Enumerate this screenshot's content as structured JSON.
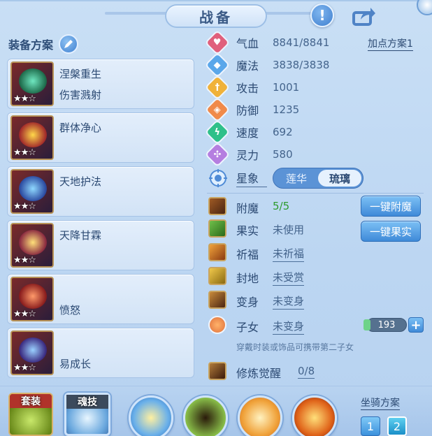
{
  "window": {
    "title": "战备"
  },
  "left": {
    "plan_title": "装备方案",
    "plans": [
      {
        "name_line1": "涅槃重生",
        "name_line2": "伤害溅射",
        "stars": "★★☆"
      },
      {
        "name_line1": "群体净心",
        "name_line2": "",
        "stars": "★★☆"
      },
      {
        "name_line1": "天地护法",
        "name_line2": "",
        "stars": "★★☆"
      },
      {
        "name_line1": "天降甘霖",
        "name_line2": "",
        "stars": "★★☆"
      },
      {
        "name_line1": "",
        "name_line2": "愤怒",
        "stars": "★★☆"
      },
      {
        "name_line1": "",
        "name_line2": "易成长",
        "stars": "★★☆"
      }
    ]
  },
  "stats": {
    "point_plan": "加点方案1",
    "rows": [
      {
        "label": "气血",
        "value": "8841/8841",
        "icon": "heart-icon",
        "color": "#e0607c"
      },
      {
        "label": "魔法",
        "value": "3838/3838",
        "icon": "mana-icon",
        "color": "#5aa7ea"
      },
      {
        "label": "攻击",
        "value": "1001",
        "icon": "sword-icon",
        "color": "#f0b23a"
      },
      {
        "label": "防御",
        "value": "1235",
        "icon": "shield-icon",
        "color": "#f08a4a"
      },
      {
        "label": "速度",
        "value": "692",
        "icon": "speed-icon",
        "color": "#2fc08a"
      },
      {
        "label": "灵力",
        "value": "580",
        "icon": "spirit-icon",
        "color": "#b57ee0"
      }
    ],
    "constellation": {
      "label": "星象",
      "options": [
        "莲华",
        "琉璃"
      ],
      "selected": "琉璃"
    }
  },
  "features": {
    "rows": [
      {
        "label": "附魔",
        "value": "5/5",
        "button": "一键附魔"
      },
      {
        "label": "果实",
        "value": "未使用",
        "button": "一键果实"
      },
      {
        "label": "祈福",
        "value": "未祈福"
      },
      {
        "label": "封地",
        "value": "未受赏"
      },
      {
        "label": "变身",
        "value": "未变身"
      },
      {
        "label": "子女",
        "value": "未变身"
      }
    ],
    "child_count": "193",
    "hint": "穿戴时装或饰品可携带第二子女",
    "cultivation": {
      "label": "修炼觉醒",
      "value": "0/8"
    }
  },
  "bottom": {
    "tabs": [
      "套装",
      "魂技"
    ],
    "mount_title": "坐骑方案",
    "mount_buttons": [
      "1",
      "2"
    ]
  },
  "colors": {
    "accent": "#3f8ad8",
    "green_value": "#2e9b2e",
    "text": "#2c4a73"
  }
}
